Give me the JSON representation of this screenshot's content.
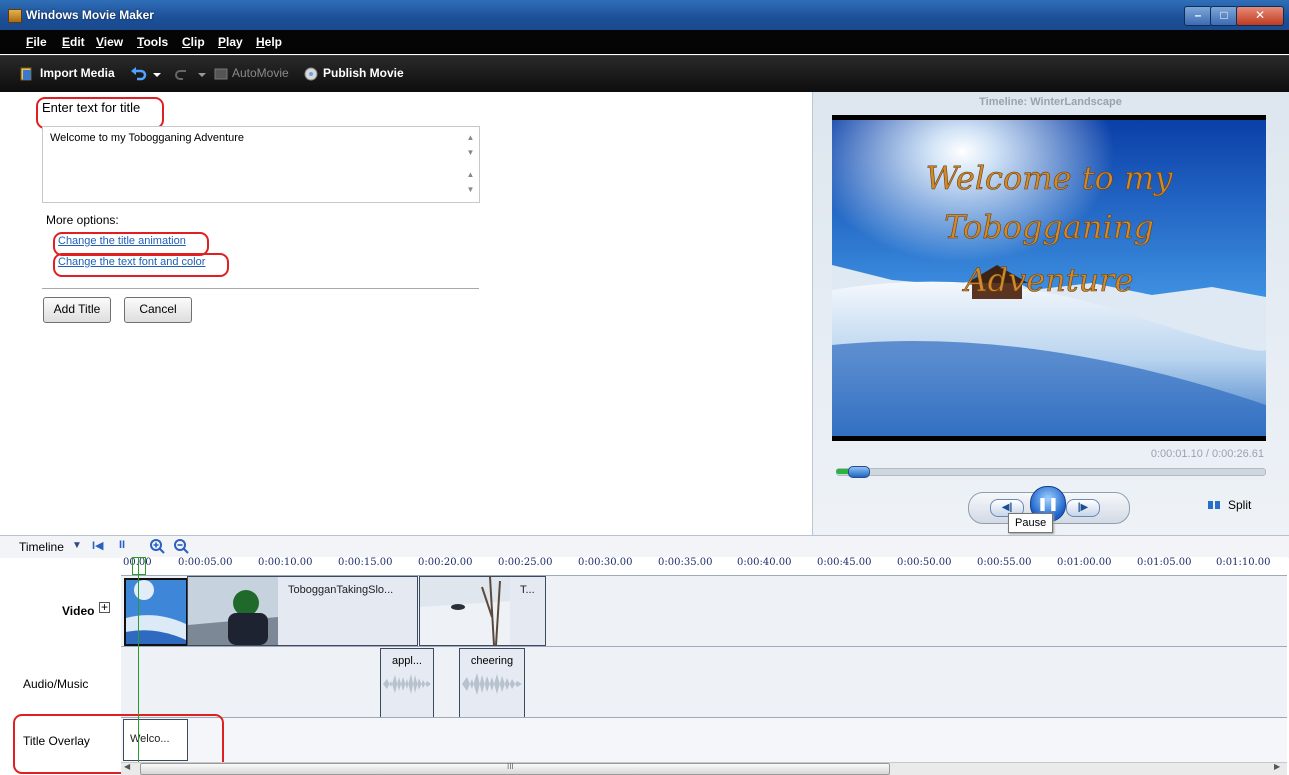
{
  "window": {
    "title": "Windows Movie Maker"
  },
  "menu": [
    "File",
    "Edit",
    "View",
    "Tools",
    "Clip",
    "Play",
    "Help"
  ],
  "toolbar": {
    "import_media": "Import Media",
    "automovie": "AutoMovie",
    "publish_movie": "Publish Movie"
  },
  "title_editor": {
    "heading": "Enter text for title",
    "text_line1": "Welcome to my Tobogganing Adventure",
    "text_line2": "",
    "more_options_label": "More options:",
    "link_animation": "Change the title animation",
    "link_font_color": "Change the text font and color",
    "add_title_button": "Add Title",
    "cancel_button": "Cancel"
  },
  "preview": {
    "timeline_name": "Timeline: WinterLandscape",
    "overlay_line1": "Welcome to my",
    "overlay_line2": "Tobogganing",
    "overlay_line3": "Adventure",
    "time_readout": "0:00:01.10 / 0:00:26.61",
    "progress_fraction": 0.041,
    "tooltip": "Pause",
    "split_label": "Split"
  },
  "timeline": {
    "label": "Timeline",
    "ruler_ticks": [
      "00.00",
      "0:00:05.00",
      "0:00:10.00",
      "0:00:15.00",
      "0:00:20.00",
      "0:00:25.00",
      "0:00:30.00",
      "0:00:35.00",
      "0:00:40.00",
      "0:00:45.00",
      "0:00:50.00",
      "0:00:55.00",
      "0:01:00.00",
      "0:01:05.00",
      "0:01:10.00"
    ],
    "tracks": {
      "video": "Video",
      "audio": "Audio/Music",
      "title_overlay": "Title Overlay"
    },
    "video_clips": [
      "TobogganTakingSlo...",
      "T..."
    ],
    "audio_clips": [
      "appl...",
      "cheering"
    ],
    "title_clips": [
      "Welco..."
    ],
    "scroll_marker": "III"
  },
  "colors": {
    "title_overlay_text": "#d08a2c",
    "highlight_red": "#e02020",
    "link_blue": "#1f5fb7",
    "playhead_green": "#2a9c2a"
  }
}
